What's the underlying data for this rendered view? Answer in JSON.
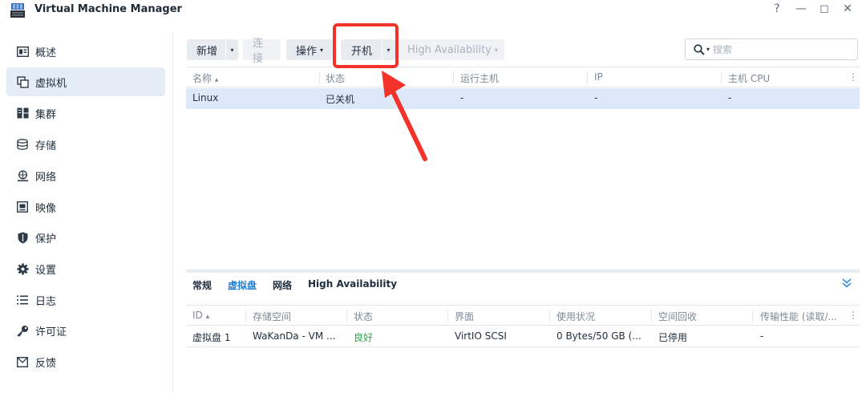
{
  "window": {
    "title": "Virtual Machine Manager"
  },
  "window_controls": {
    "help": "?",
    "minimize": "—",
    "maximize": "◻",
    "close": "✕"
  },
  "sidebar": {
    "items": [
      {
        "label": "概述",
        "icon": "overview-icon"
      },
      {
        "label": "虚拟机",
        "icon": "virtual-machine-icon",
        "active": true
      },
      {
        "label": "集群",
        "icon": "cluster-icon"
      },
      {
        "label": "存储",
        "icon": "storage-icon"
      },
      {
        "label": "网络",
        "icon": "network-icon"
      },
      {
        "label": "映像",
        "icon": "image-icon"
      },
      {
        "label": "保护",
        "icon": "shield-icon"
      },
      {
        "label": "设置",
        "icon": "gear-icon"
      },
      {
        "label": "日志",
        "icon": "log-icon"
      },
      {
        "label": "许可证",
        "icon": "key-icon"
      },
      {
        "label": "反馈",
        "icon": "feedback-icon"
      }
    ]
  },
  "toolbar": {
    "create": "新增",
    "connect": "连接",
    "action": "操作",
    "power_on": "开机",
    "high_availability": "High Availability"
  },
  "search": {
    "placeholder": "搜索"
  },
  "vm_table": {
    "columns": [
      "名称",
      "状态",
      "运行主机",
      "IP",
      "主机 CPU"
    ],
    "sort_indicator": "▴",
    "rows": [
      {
        "name": "Linux",
        "status": "已关机",
        "host": "-",
        "ip": "-",
        "cpu": "-"
      }
    ]
  },
  "detail_panel": {
    "tabs": [
      "常规",
      "虚拟盘",
      "网络",
      "High Availability"
    ],
    "active_tab": "虚拟盘",
    "columns": [
      "ID",
      "存储空间",
      "状态",
      "界面",
      "使用状况",
      "空间回收",
      "传输性能 (读取/..."
    ],
    "rows": [
      {
        "id": "虚拟盘 1",
        "storage": "WaKanDa - VM ...",
        "status": "良好",
        "interface": "VirtIO SCSI",
        "usage": "0 Bytes/50 GB (...",
        "reclaim": "已停用",
        "perf": "-"
      }
    ]
  },
  "colors": {
    "accent": "#1f7ed8",
    "selected_row": "#dde9f8",
    "highlight": "#f4322a",
    "ok": "#28a745"
  }
}
